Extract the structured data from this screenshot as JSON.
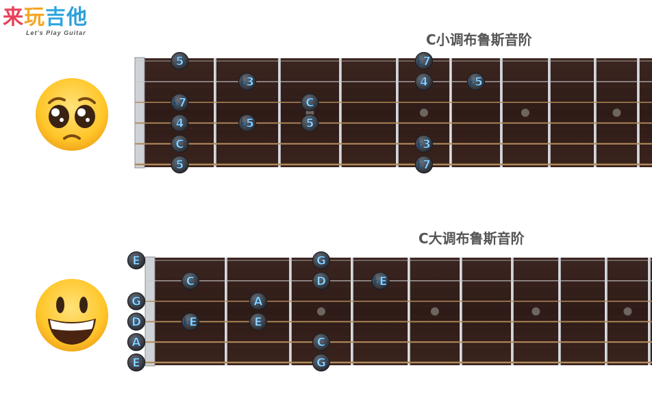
{
  "logo": {
    "chars": [
      {
        "t": "来",
        "color": "#e8415a"
      },
      {
        "t": "玩",
        "color": "#f5a623"
      },
      {
        "t": "吉",
        "color": "#2fa7df"
      },
      {
        "t": "他",
        "color": "#2c9fd8"
      }
    ],
    "subtitle": "Let's Play Guitar"
  },
  "boards": [
    {
      "id": "minor",
      "title": "C小调布鲁斯音阶",
      "emoji": "pleading-face-icon",
      "inlays": [
        3,
        5,
        7,
        9
      ],
      "notes": [
        {
          "s": 1,
          "f": 1,
          "l": "5"
        },
        {
          "s": 1,
          "f": 5,
          "l": "♭7"
        },
        {
          "s": 2,
          "f": 2,
          "l": "♭3"
        },
        {
          "s": 2,
          "f": 5,
          "l": "4"
        },
        {
          "s": 2,
          "f": 6,
          "l": "♭5"
        },
        {
          "s": 3,
          "f": 1,
          "l": "♭7"
        },
        {
          "s": 3,
          "f": 3,
          "l": "C"
        },
        {
          "s": 4,
          "f": 1,
          "l": "4"
        },
        {
          "s": 4,
          "f": 2,
          "l": "♭5"
        },
        {
          "s": 4,
          "f": 3,
          "l": "5"
        },
        {
          "s": 5,
          "f": 1,
          "l": "C"
        },
        {
          "s": 5,
          "f": 5,
          "l": "♭3"
        },
        {
          "s": 6,
          "f": 1,
          "l": "5"
        },
        {
          "s": 6,
          "f": 5,
          "l": "♭7"
        }
      ]
    },
    {
      "id": "major",
      "title": "C大调布鲁斯音阶",
      "emoji": "grinning-face-icon",
      "inlays": [
        3,
        5,
        7,
        9
      ],
      "notes": [
        {
          "s": 1,
          "f": 0,
          "l": "E"
        },
        {
          "s": 1,
          "f": 3,
          "l": "G"
        },
        {
          "s": 2,
          "f": 1,
          "l": "C"
        },
        {
          "s": 2,
          "f": 3,
          "l": "D"
        },
        {
          "s": 2,
          "f": 4,
          "l": "♭E"
        },
        {
          "s": 3,
          "f": 0,
          "l": "G"
        },
        {
          "s": 3,
          "f": 2,
          "l": "A"
        },
        {
          "s": 4,
          "f": 0,
          "l": "D"
        },
        {
          "s": 4,
          "f": 1,
          "l": "♭E"
        },
        {
          "s": 4,
          "f": 2,
          "l": "E"
        },
        {
          "s": 5,
          "f": 0,
          "l": "A"
        },
        {
          "s": 5,
          "f": 3,
          "l": "C"
        },
        {
          "s": 6,
          "f": 0,
          "l": "E"
        },
        {
          "s": 6,
          "f": 3,
          "l": "G"
        }
      ]
    }
  ]
}
